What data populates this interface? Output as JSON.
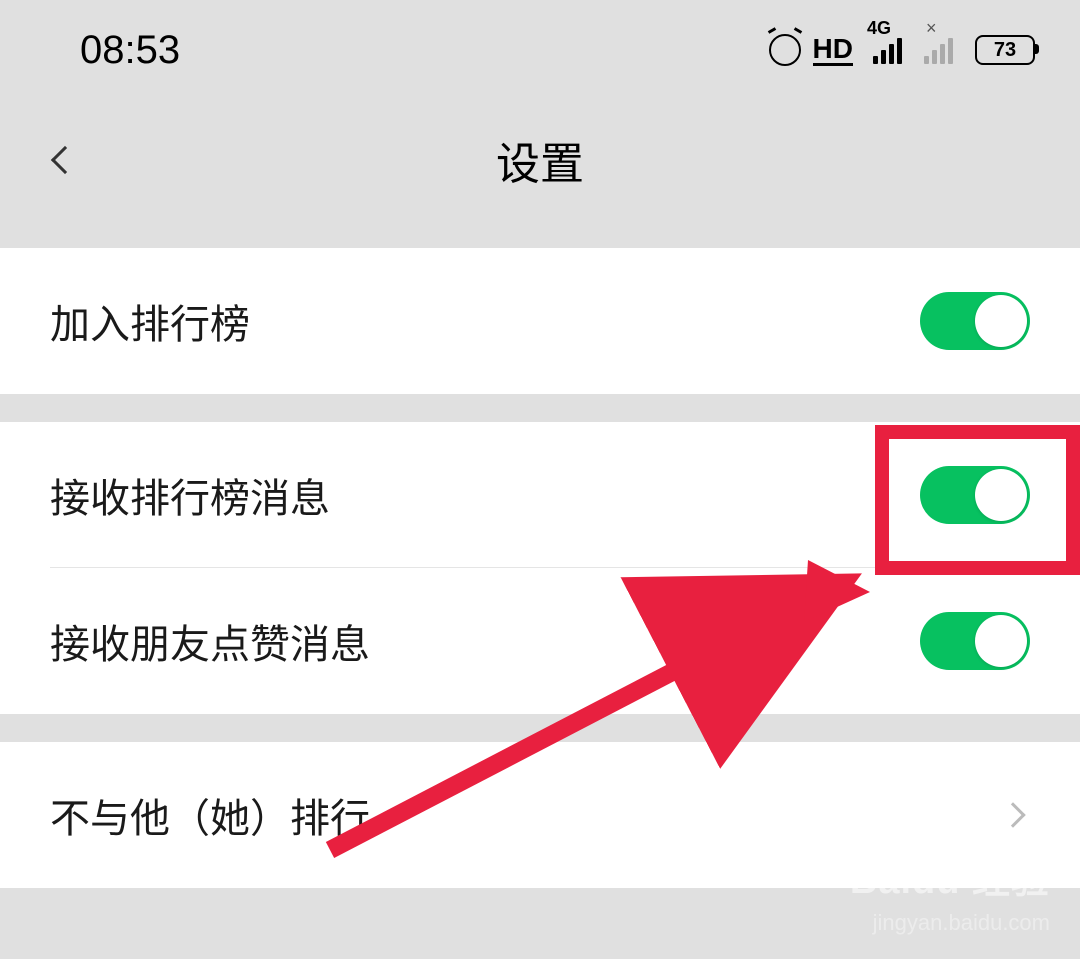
{
  "status_bar": {
    "time": "08:53",
    "hd_label": "HD",
    "network_label": "4G",
    "battery_level": "73"
  },
  "nav": {
    "title": "设置"
  },
  "settings": {
    "row1_label": "加入排行榜",
    "row2_label": "接收排行榜消息",
    "row3_label": "接收朋友点赞消息",
    "row4_label": "不与他（她）排行"
  },
  "watermark": {
    "brand": "Baidu 经验",
    "url": "jingyan.baidu.com"
  }
}
